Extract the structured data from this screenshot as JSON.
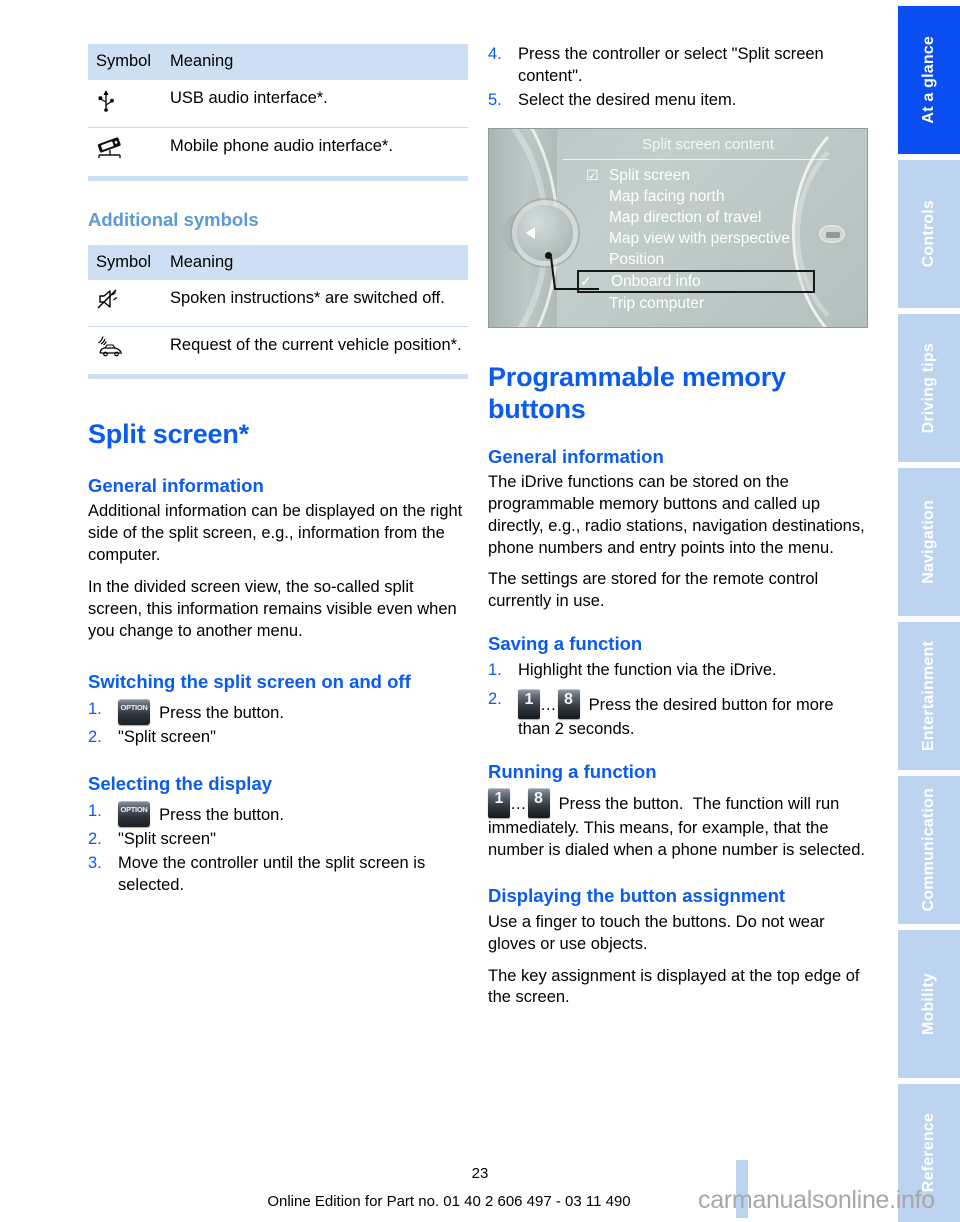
{
  "document": {
    "page_number": "23",
    "footer": "Online Edition for Part no. 01 40 2 606 497 - 03 11 490",
    "watermark": "carmanualsonline.info"
  },
  "sidebar": {
    "items": [
      {
        "label": "At a glance",
        "active": true
      },
      {
        "label": "Controls",
        "active": false
      },
      {
        "label": "Driving tips",
        "active": false
      },
      {
        "label": "Navigation",
        "active": false
      },
      {
        "label": "Entertainment",
        "active": false
      },
      {
        "label": "Communication",
        "active": false
      },
      {
        "label": "Mobility",
        "active": false
      },
      {
        "label": "Reference",
        "active": false
      }
    ]
  },
  "left_column": {
    "table_one": {
      "headers": [
        "Symbol",
        "Meaning"
      ],
      "rows": [
        {
          "symbol_icon": "usb-icon",
          "meaning": "USB audio interface*."
        },
        {
          "symbol_icon": "phone-cradle-icon",
          "meaning": "Mobile phone audio interface*."
        }
      ]
    },
    "additional_symbols_heading": "Additional symbols",
    "table_two": {
      "headers": [
        "Symbol",
        "Meaning"
      ],
      "rows": [
        {
          "symbol_icon": "muted-speaker-icon",
          "meaning": "Spoken instructions* are switched off."
        },
        {
          "symbol_icon": "car-voice-request-icon",
          "meaning": "Request of the current vehicle position*."
        }
      ]
    },
    "split_screen": {
      "title": "Split screen*",
      "general_information": {
        "heading": "General information",
        "paragraphs": [
          "Additional information can be displayed on the right side of the split screen, e.g., information from the computer.",
          "In the divided screen view, the so-called split screen, this information remains visible even when you change to another menu."
        ]
      },
      "switching": {
        "heading": "Switching the split screen on and off",
        "steps": [
          {
            "num": "1.",
            "icon": "option-button-icon",
            "text": "Press the button."
          },
          {
            "num": "2.",
            "icon": null,
            "text": "\"Split screen\""
          }
        ]
      },
      "selecting": {
        "heading": "Selecting the display",
        "steps": [
          {
            "num": "1.",
            "icon": "option-button-icon",
            "text": "Press the button."
          },
          {
            "num": "2.",
            "icon": null,
            "text": "\"Split screen\""
          },
          {
            "num": "3.",
            "icon": null,
            "text": "Move the controller until the split screen is selected."
          }
        ]
      }
    }
  },
  "right_column": {
    "continued_steps": [
      {
        "num": "4.",
        "text": "Press the controller or select \"Split screen content\"."
      },
      {
        "num": "5.",
        "text": "Select the desired menu item."
      }
    ],
    "idrive_screen": {
      "header": "Split screen content",
      "menu_items": [
        {
          "label": "Split screen",
          "mark": "checkbox",
          "selected": false
        },
        {
          "label": "Map facing north",
          "mark": null,
          "selected": false
        },
        {
          "label": "Map direction of travel",
          "mark": null,
          "selected": false
        },
        {
          "label": "Map view with perspective",
          "mark": null,
          "selected": false
        },
        {
          "label": "Position",
          "mark": null,
          "selected": false
        },
        {
          "label": "Onboard info",
          "mark": "check",
          "selected": true
        },
        {
          "label": "Trip computer",
          "mark": null,
          "selected": false
        }
      ]
    },
    "memory_buttons": {
      "title": "Programmable memory buttons",
      "general_information": {
        "heading": "General information",
        "paragraphs": [
          "The iDrive functions can be stored on the programmable memory buttons and called up directly, e.g., radio stations, navigation destinations, phone numbers and entry points into the menu.",
          "The settings are stored for the remote control currently in use."
        ]
      },
      "saving": {
        "heading": "Saving a function",
        "steps": [
          {
            "num": "1.",
            "text": "Highlight the function via the iDrive."
          },
          {
            "num": "2.",
            "text": "Press the desired button for more than 2 seconds.",
            "btn_from": "1",
            "btn_to": "8"
          }
        ]
      },
      "running": {
        "heading": "Running a function",
        "btn_from": "1",
        "btn_to": "8",
        "line_one": "Press the button.",
        "line_two": "The function will run immediately. This means, for example, that the number is dialed when a phone number is selected."
      },
      "displaying": {
        "heading": "Displaying the button assignment",
        "paragraphs": [
          "Use a finger to touch the buttons. Do not wear gloves or use objects.",
          "The key assignment is displayed at the top edge of the screen."
        ]
      }
    }
  },
  "colors": {
    "accent_blue": "#0a5bf0",
    "table_header_blue": "#cfdff3",
    "sidebar_inactive": "#bcd4ef",
    "sidebar_active": "#0a4df0",
    "muted_heading": "#5b9bd5"
  }
}
